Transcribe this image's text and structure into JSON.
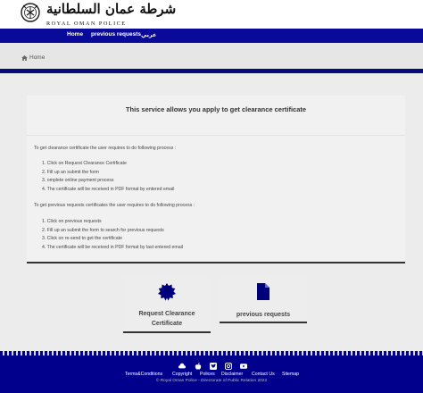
{
  "header": {
    "logo_arabic": "شرطة عمان السلطانية",
    "logo_latin": "ROYAL OMAN POLICE",
    "emblem_icon": "rop-emblem-icon"
  },
  "nav": {
    "items": [
      {
        "label": "Home"
      },
      {
        "label": "previous requests"
      },
      {
        "label": "عربي"
      }
    ]
  },
  "breadcrumb": {
    "icon": "home-icon",
    "label": "Home"
  },
  "main": {
    "title": "This service allows you apply to get clearance certificate",
    "intro1": "To get clearance certificate the user requires to do following process :",
    "steps1": [
      "1. Click on Request Clearance Certificate",
      "2. Fill up an submit the form",
      "3. omplete online payment process",
      "4. The certificate will be received in PDF format by entered email"
    ],
    "intro2": "To get previous requests certificates the user requires to do following process :",
    "steps2": [
      "1. Click on previous requests",
      "2. Fill up an submit the form to search for previous requests",
      "3. Click on re-send to get the certificate",
      "4. The certificate will be received in PDF format by last entered email"
    ]
  },
  "tiles": [
    {
      "line1": "Request Clearance",
      "line2": "Certificate",
      "icon": "certificate-seal-icon"
    },
    {
      "label": "previous requests",
      "icon": "document-icon"
    }
  ],
  "footer": {
    "social_icons": [
      "cloud-icon",
      "apple-icon",
      "twitter-icon",
      "instagram-icon",
      "youtube-icon"
    ],
    "links": [
      "Terms&Conditions",
      "Copyright",
      "Polices",
      "Disclaimer",
      "Contact Us",
      "Sitemap"
    ],
    "copyright": "© Royal Oman Police - Directorate of Public Relation 2022"
  },
  "colors": {
    "brand_blue": "#0a0a9a",
    "footer_blue": "#00008c",
    "page_bg": "#ececec"
  }
}
